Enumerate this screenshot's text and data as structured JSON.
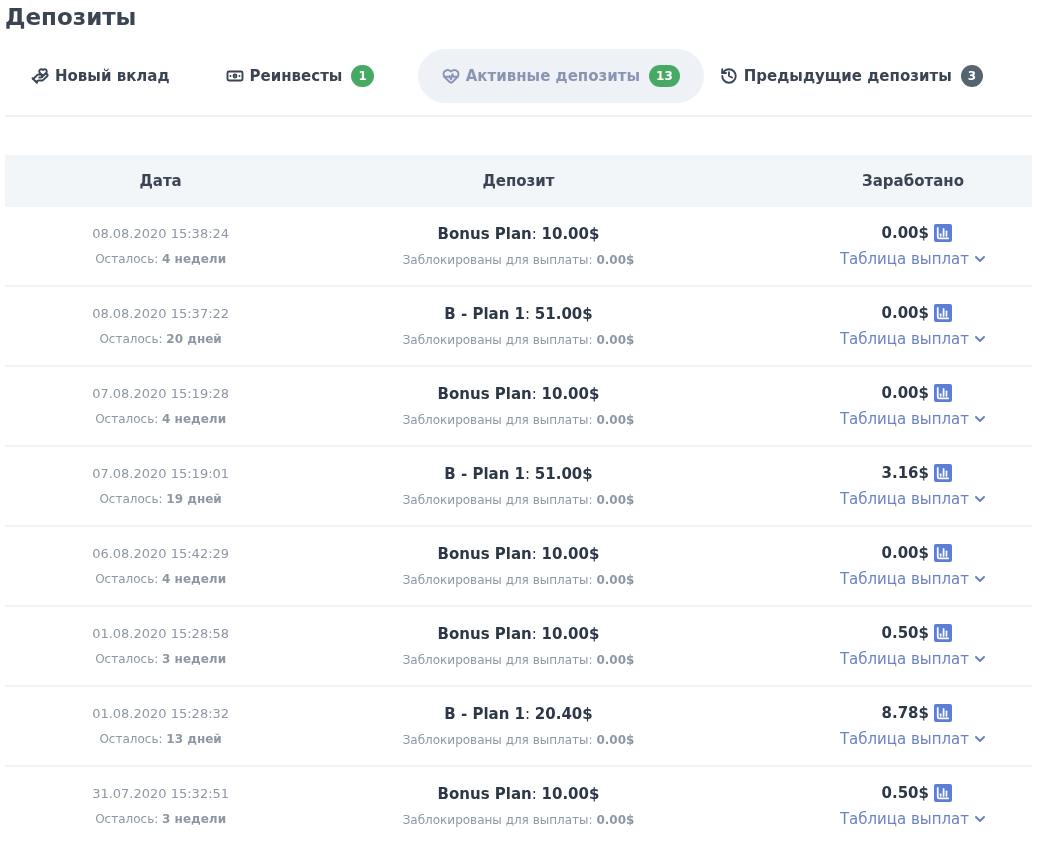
{
  "title": "Депозиты",
  "tabs": [
    {
      "label": "Новый вклад",
      "selected": false
    },
    {
      "label": "Реинвесты",
      "selected": false,
      "badge": "1",
      "color": "#48a964"
    },
    {
      "label": "Активные депозиты",
      "selected": true,
      "badge": "13",
      "color": "#48a964"
    },
    {
      "label": "Предыдущие депозиты",
      "selected": false,
      "badge": "3",
      "color": "#56646f"
    }
  ],
  "table": {
    "columns": [
      "Дата",
      "Депозит",
      "Заработано"
    ],
    "rows": [
      {
        "date": "08.08.2020 15:38:24",
        "remaining": "Осталось: **4 недели**",
        "deposit": "**Bonus Plan**: **10.00$**",
        "blocked": "Заблокированы для выплаты: **0.00$**",
        "earned": "0.00$",
        "payout_link": "Таблица выплат"
      },
      {
        "date": "08.08.2020 15:37:22",
        "remaining": "Осталось: **20 дней**",
        "deposit": "**B - Plan 1**: **51.00$**",
        "blocked": "Заблокированы для выплаты: **0.00$**",
        "earned": "0.00$",
        "payout_link": "Таблица выплат"
      },
      {
        "date": "07.08.2020 15:19:28",
        "remaining": "Осталось: **4 недели**",
        "deposit": "**Bonus Plan**: **10.00$**",
        "blocked": "Заблокированы для выплаты: **0.00$**",
        "earned": "0.00$",
        "payout_link": "Таблица выплат"
      },
      {
        "date": "07.08.2020 15:19:01",
        "remaining": "Осталось: **19 дней**",
        "deposit": "**B - Plan 1**: **51.00$**",
        "blocked": "Заблокированы для выплаты: **0.00$**",
        "earned": "3.16$",
        "payout_link": "Таблица выплат"
      },
      {
        "date": "06.08.2020 15:42:29",
        "remaining": "Осталось: **4 недели**",
        "deposit": "**Bonus Plan**: **10.00$**",
        "blocked": "Заблокированы для выплаты: **0.00$**",
        "earned": "0.00$",
        "payout_link": "Таблица выплат"
      },
      {
        "date": "01.08.2020 15:28:58",
        "remaining": "Осталось: **3 недели**",
        "deposit": "**Bonus Plan**: **10.00$**",
        "blocked": "Заблокированы для выплаты: **0.00$**",
        "earned": "0.50$",
        "payout_link": "Таблица выплат"
      },
      {
        "date": "01.08.2020 15:28:32",
        "remaining": "Осталось: **13 дней**",
        "deposit": "**B - Plan 1**: **20.40$**",
        "blocked": "Заблокированы для выплаты: **0.00$**",
        "earned": "8.78$",
        "payout_link": "Таблица выплат"
      },
      {
        "date": "31.07.2020 15:32:51",
        "remaining": "Осталось: **3 недели**",
        "deposit": "**Bonus Plan**: **10.00$**",
        "blocked": "Заблокированы для выплаты: **0.00$**",
        "earned": "0.50$",
        "payout_link": "Таблица выплат"
      }
    ]
  }
}
